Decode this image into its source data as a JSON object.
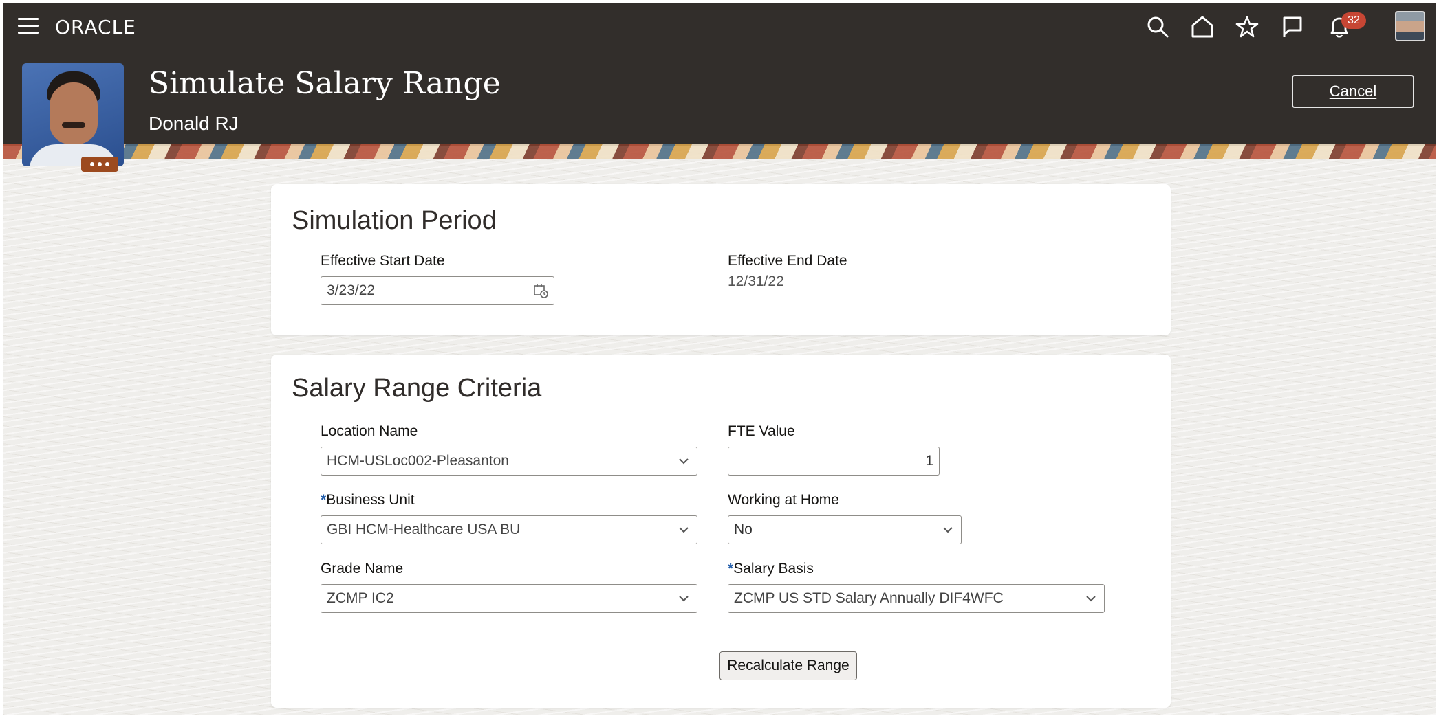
{
  "nav": {
    "brand": "ORACLE",
    "notification_count": "32",
    "icons": [
      "hamburger-icon",
      "search-icon",
      "home-icon",
      "star-icon",
      "flag-icon",
      "bell-icon"
    ]
  },
  "header": {
    "title": "Simulate Salary Range",
    "person_name": "Donald RJ",
    "cancel_label": "Cancel"
  },
  "simulation_period": {
    "title": "Simulation Period",
    "start_label": "Effective Start Date",
    "start_value": "3/23/22",
    "end_label": "Effective End Date",
    "end_value": "12/31/22"
  },
  "criteria": {
    "title": "Salary Range Criteria",
    "location_label": "Location Name",
    "location_value": "HCM-USLoc002-Pleasanton",
    "fte_label": "FTE Value",
    "fte_value": "1",
    "business_unit_label": "Business Unit",
    "business_unit_value": "GBI HCM-Healthcare USA BU",
    "working_home_label": "Working at Home",
    "working_home_value": "No",
    "grade_label": "Grade Name",
    "grade_value": "ZCMP IC2",
    "salary_basis_label": "Salary Basis",
    "salary_basis_value": "ZCMP US STD Salary Annually DIF4WFC",
    "required_marker": "*",
    "recalculate_label": "Recalculate Range"
  },
  "colors": {
    "header_bg": "#322e2b",
    "required": "#1e5aa8",
    "badge": "#c74634"
  }
}
